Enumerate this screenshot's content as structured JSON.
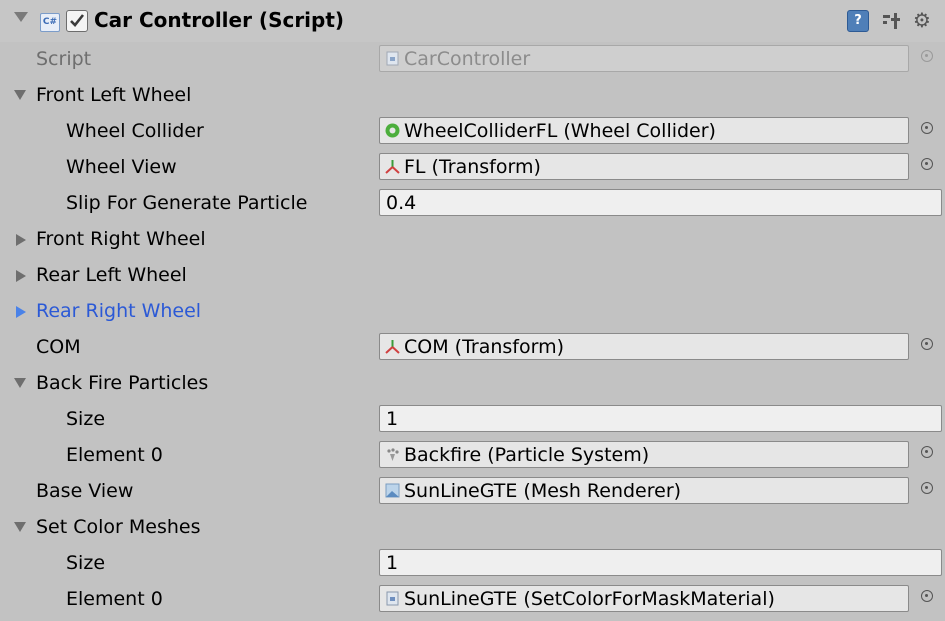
{
  "header": {
    "script_badge": "C#",
    "title": "Car Controller (Script)",
    "help_glyph": "?",
    "gear_glyph": "⚙"
  },
  "rows": {
    "script_label": "Script",
    "script_value": "CarController",
    "front_left_label": "Front Left Wheel",
    "wheel_collider_label": "Wheel Collider",
    "wheel_collider_value": "WheelColliderFL (Wheel Collider)",
    "wheel_view_label": "Wheel View",
    "wheel_view_value": "FL (Transform)",
    "slip_label": "Slip For Generate Particle",
    "slip_value": "0.4",
    "front_right_label": "Front Right Wheel",
    "rear_left_label": "Rear Left Wheel",
    "rear_right_label": "Rear Right Wheel",
    "com_label": "COM",
    "com_value": "COM (Transform)",
    "backfire_label": "Back Fire Particles",
    "backfire_size_label": "Size",
    "backfire_size_value": "1",
    "backfire_el0_label": "Element 0",
    "backfire_el0_value": "Backfire (Particle System)",
    "base_view_label": "Base View",
    "base_view_value": "SunLineGTE (Mesh Renderer)",
    "set_color_label": "Set Color Meshes",
    "set_color_size_label": "Size",
    "set_color_size_value": "1",
    "set_color_el0_label": "Element 0",
    "set_color_el0_value": "SunLineGTE (SetColorForMaskMaterial)"
  },
  "colors": {
    "background": "#c2c2c2",
    "selected_foldout_text": "#2b59d6",
    "disabled_text": "#8c8c8c"
  },
  "icons": {
    "script_component": "csharp-script-icon",
    "enabled_toggle": "checkbox-checked-icon",
    "help": "help-book-icon",
    "preset": "preset-sliders-icon",
    "settings": "gear-icon",
    "wheel_collider": "wheel-collider-icon",
    "transform": "transform-axes-icon",
    "particle_system": "particle-system-icon",
    "mesh_renderer": "mesh-renderer-icon",
    "script_asset": "script-asset-icon",
    "object_picker": "object-picker-icon"
  }
}
